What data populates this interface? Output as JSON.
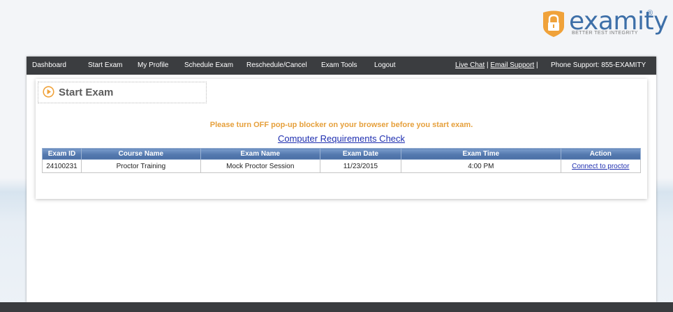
{
  "logo": {
    "word": "examity",
    "reg": "®",
    "tagline": "BETTER TEST INTEGRITY"
  },
  "nav": {
    "items": [
      "Dashboard",
      "Start Exam",
      "My Profile",
      "Schedule Exam",
      "Reschedule/Cancel",
      "Exam Tools",
      "Logout"
    ],
    "live_chat": "Live Chat",
    "email_support": "Email Support",
    "separator": "|",
    "phone_support": "Phone Support: 855-EXAMITY"
  },
  "section": {
    "title": "Start Exam",
    "icon": "play-circle-icon"
  },
  "warning": "Please turn OFF pop-up blocker on your browser before you start exam.",
  "requirements_link": "Computer Requirements Check",
  "table": {
    "headers": [
      "Exam ID",
      "Course Name",
      "Exam Name",
      "Exam Date",
      "Exam Time",
      "Action"
    ],
    "rows": [
      [
        "24100231",
        "Proctor Training",
        "Mock Proctor Session",
        "11/23/2015",
        "4:00 PM",
        "Connect to proctor"
      ]
    ]
  },
  "colors": {
    "nav_bg": "#3b3d40",
    "brand_blue": "#3d6fa8",
    "brand_orange": "#f0a23a",
    "warning_text": "#e6a03c",
    "table_header": "#5378ae",
    "link": "#1f2fb0"
  }
}
